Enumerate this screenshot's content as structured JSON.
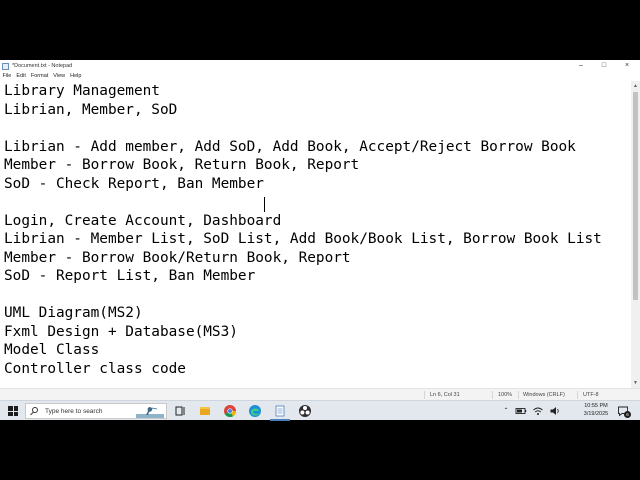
{
  "window": {
    "title": "*Document.txt - Notepad",
    "controls": [
      "–",
      "□",
      "×"
    ]
  },
  "menu": [
    "File",
    "Edit",
    "Format",
    "View",
    "Help"
  ],
  "editor": {
    "lines": [
      "Library Management",
      "Librian, Member, SoD",
      "",
      "Librian - Add member, Add SoD, Add Book, Accept/Reject Borrow Book",
      "Member - Borrow Book, Return Book, Report",
      "SoD - Check Report, Ban Member",
      "",
      "Login, Create Account, Dashboard",
      "Librian - Member List, SoD List, Add Book/Book List, Borrow Book List",
      "Member - Borrow Book/Return Book, Report",
      "SoD - Report List, Ban Member",
      "",
      "UML Diagram(MS2)",
      "Fxml Design + Database(MS3)",
      "Model Class",
      "Controller class code"
    ]
  },
  "status": {
    "position": "Ln 6, Col 31",
    "zoom": "100%",
    "line_ending": "Windows (CRLF)",
    "encoding": "UTF-8"
  },
  "taskbar": {
    "search_placeholder": "Type here to search",
    "apps": [
      "task-view-icon",
      "file-explorer-icon",
      "chrome-icon",
      "edge-icon",
      "notepad-icon",
      "obs-icon"
    ],
    "tray": [
      "chevron-up-icon",
      "battery-icon",
      "network-icon",
      "volume-icon"
    ],
    "time": "10:55 PM",
    "date": "3/19/2025",
    "notification_count": "6"
  },
  "colors": {
    "accent": "#4a7dbb",
    "taskbar_bg": "#e3e8ee"
  }
}
